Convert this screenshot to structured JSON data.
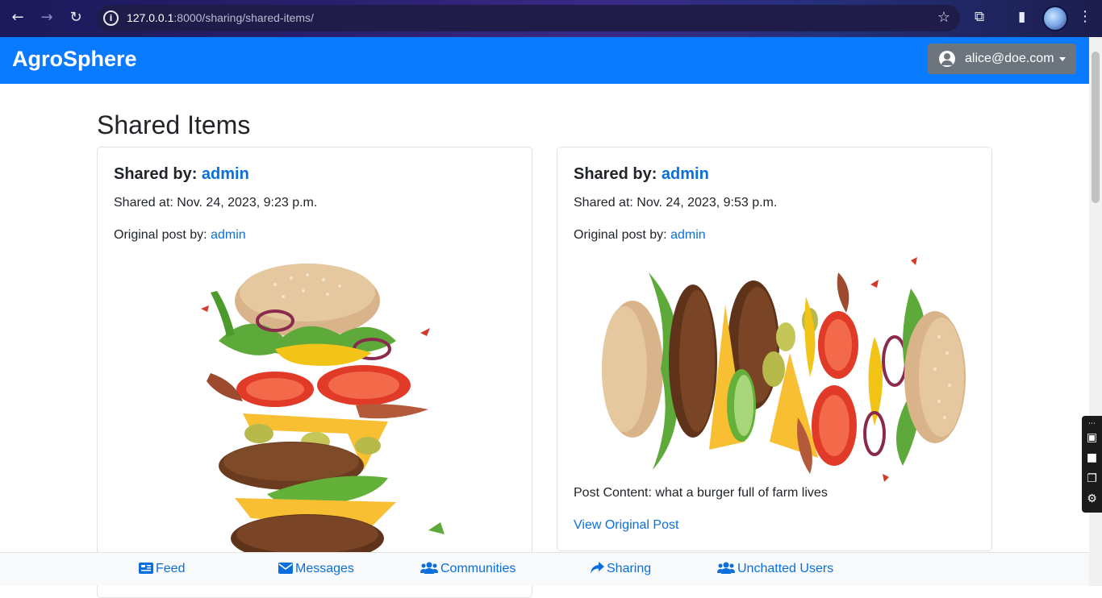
{
  "browser": {
    "url_host": "127.0.0.1",
    "url_path": ":8000/sharing/shared-items/"
  },
  "navbar": {
    "brand": "AgroSphere",
    "user_email": "alice@doe.com"
  },
  "page": {
    "title": "Shared Items"
  },
  "cards": [
    {
      "shared_by_label": "Shared by:",
      "shared_by_user": "admin",
      "shared_at": "Shared at: Nov. 24, 2023, 9:23 p.m.",
      "original_post_label": "Original post by:",
      "original_post_user": "admin",
      "image_alt": "burger-stacked-vertical"
    },
    {
      "shared_by_label": "Shared by:",
      "shared_by_user": "admin",
      "shared_at": "Shared at: Nov. 24, 2023, 9:53 p.m.",
      "original_post_label": "Original post by:",
      "original_post_user": "admin",
      "image_alt": "burger-stacked-horizontal",
      "post_content": "Post Content: what a burger full of farm lives",
      "view_link": "View Original Post"
    }
  ],
  "bottom_nav": [
    {
      "label": "Feed",
      "icon": "newspaper-icon"
    },
    {
      "label": "Messages",
      "icon": "envelope-icon"
    },
    {
      "label": "Communities",
      "icon": "users-icon"
    },
    {
      "label": "Sharing",
      "icon": "share-icon"
    },
    {
      "label": "Unchatted Users",
      "icon": "users-icon"
    }
  ],
  "colors": {
    "navbar": "#0a7bff",
    "link": "#0a6fdd",
    "user_button": "#6c757d"
  }
}
